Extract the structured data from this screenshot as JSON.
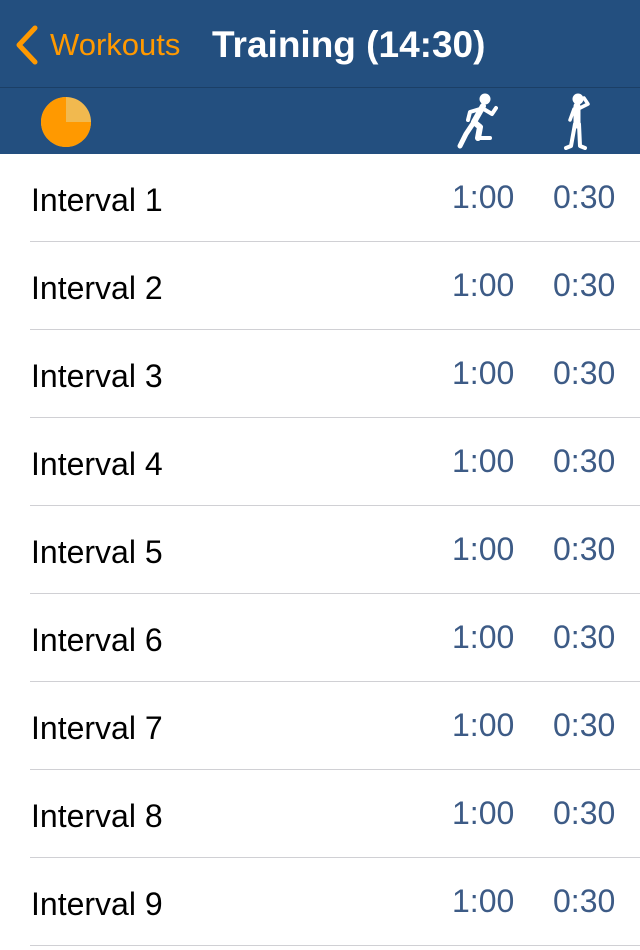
{
  "nav": {
    "back_label": "Workouts",
    "title": "Training (14:30)"
  },
  "header": {
    "progress_icon": "progress-pie-icon",
    "progress_fraction": 0.75,
    "run_icon": "running-person-icon",
    "rest_icon": "standing-person-icon"
  },
  "colors": {
    "nav_background": "#234f7f",
    "accent": "#ff9900",
    "time_text": "#3d5b86"
  },
  "intervals": [
    {
      "name": "Interval 1",
      "run": "1:00",
      "rest": "0:30"
    },
    {
      "name": "Interval 2",
      "run": "1:00",
      "rest": "0:30"
    },
    {
      "name": "Interval 3",
      "run": "1:00",
      "rest": "0:30"
    },
    {
      "name": "Interval 4",
      "run": "1:00",
      "rest": "0:30"
    },
    {
      "name": "Interval 5",
      "run": "1:00",
      "rest": "0:30"
    },
    {
      "name": "Interval 6",
      "run": "1:00",
      "rest": "0:30"
    },
    {
      "name": "Interval 7",
      "run": "1:00",
      "rest": "0:30"
    },
    {
      "name": "Interval 8",
      "run": "1:00",
      "rest": "0:30"
    },
    {
      "name": "Interval 9",
      "run": "1:00",
      "rest": "0:30"
    }
  ]
}
